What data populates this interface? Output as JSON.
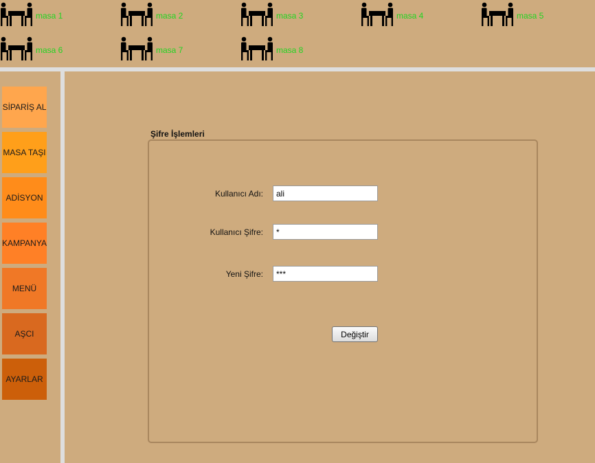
{
  "tables": [
    {
      "label": "masa 1"
    },
    {
      "label": "masa 2"
    },
    {
      "label": "masa 3"
    },
    {
      "label": "masa 4"
    },
    {
      "label": "masa 5"
    },
    {
      "label": "masa 6"
    },
    {
      "label": "masa 7"
    },
    {
      "label": "masa 8"
    }
  ],
  "table_icon": "dining-table-icon",
  "sidebar": {
    "items": [
      {
        "label": "SİPARİŞ AL",
        "color": "#ffa64d"
      },
      {
        "label": "MASA TAŞI",
        "color": "#ff9f1a"
      },
      {
        "label": "ADİSYON",
        "color": "#ff8c1a"
      },
      {
        "label": "KAMPANYA",
        "color": "#ff8026"
      },
      {
        "label": "MENÜ",
        "color": "#f07826"
      },
      {
        "label": "AŞCI",
        "color": "#d9691f"
      },
      {
        "label": "AYARLAR",
        "color": "#cc5f0a"
      }
    ]
  },
  "panel": {
    "title": "Şifre  İşlemleri",
    "username_label": "Kullanıcı Adı:",
    "username_value": "ali",
    "password_label": "Kullanıcı Şifre:",
    "password_value": "*",
    "new_password_label": "Yeni Şifre:",
    "new_password_value": "***",
    "submit_label": "Değiştir"
  },
  "colors": {
    "background": "#ceab7e",
    "table_label": "#22d422",
    "divider": "#dedede"
  }
}
